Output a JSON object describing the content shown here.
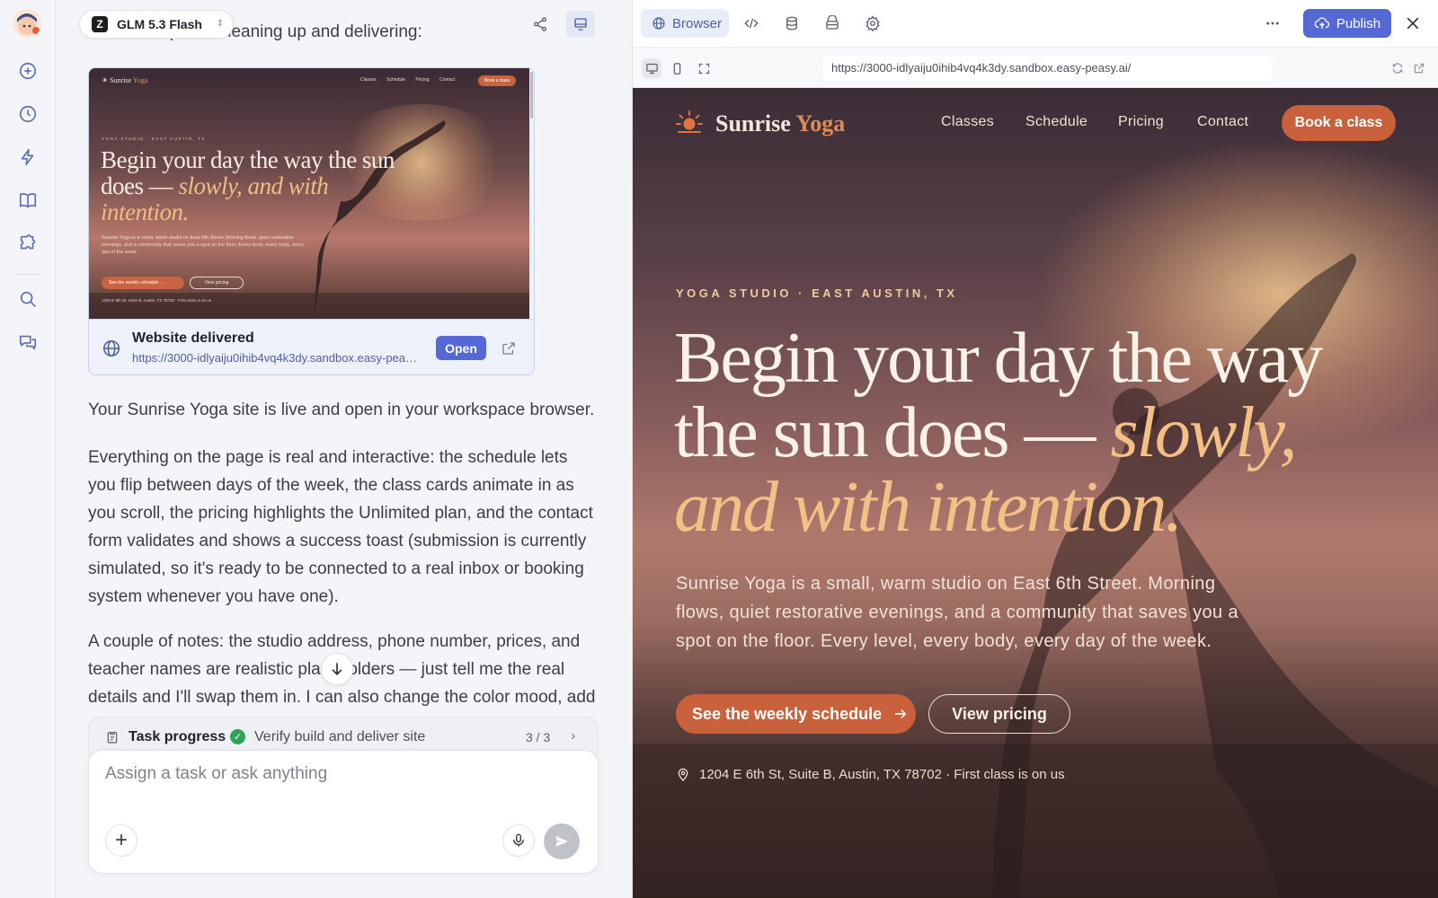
{
  "rail": {
    "icons": [
      "new-chat-icon",
      "history-icon",
      "bolt-icon",
      "book-icon",
      "puzzle-icon",
      "search-icon",
      "chat-bubbles-icon"
    ]
  },
  "chat": {
    "model_name": "GLM 5.3 Flash",
    "cut_text": "All checks pass. Cleaning up and delivering:",
    "preview": {
      "mini_brand": "Sunrise",
      "mini_brand_accent": "Yoga",
      "mini_nav": "Classes Schedule Pricing Contact",
      "mini_book": "Book a class",
      "mini_eyebrow": "YOGA STUDIO · EAST AUSTIN, TX",
      "mini_head_1": "Begin your day the way the sun does —",
      "mini_head_italic": "slowly, and with intention.",
      "mini_desc": "Sunrise Yoga is a small, warm studio on East 6th Street. Morning flows, quiet restorative evenings, and a community that saves you a spot on the floor. Every level, every body, every day of the week.",
      "mini_cta1": "See the weekly schedule →",
      "mini_cta2": "View pricing",
      "mini_addr": "1204 E 6th St, Suite B, Austin, TX 78702 · First class is on us",
      "title": "Website delivered",
      "link": "https://3000-idlyaiju0ihib4vq4k3dy.sandbox.easy-peasy.ai/",
      "open_label": "Open"
    },
    "paragraphs": [
      "Your Sunrise Yoga site is live and open in your workspace browser.",
      "Everything on the page is real and interactive: the schedule lets you flip between days of the week, the class cards animate in as you scroll, the pricing highlights the Unlimited plan, and the contact form validates and shows a success toast (submission is currently simulated, so it's ready to be connected to a real inbox or booking system whenever you have one).",
      "A couple of notes: the studio address, phone number, prices, and teacher names are realistic placeholders — just tell me the real details and I'll swap them in. I can also change the color mood, add"
    ],
    "task": {
      "title": "Task progress",
      "step": "Verify build and deliver site",
      "count": "3 / 3"
    },
    "input_placeholder": "Assign a task or ask anything"
  },
  "browser": {
    "tab_label": "Browser",
    "publish_label": "Publish",
    "url": "https://3000-idlyaiju0ihib4vq4k3dy.sandbox.easy-peasy.ai/"
  },
  "site": {
    "brand": "Sunrise",
    "brand_accent": "Yoga",
    "nav": [
      "Classes",
      "Schedule",
      "Pricing",
      "Contact"
    ],
    "book_label": "Book a class",
    "eyebrow": "YOGA STUDIO · EAST AUSTIN, TX",
    "headline_1": "Begin your day the way",
    "headline_2": "the sun does —",
    "headline_italic_a": "slowly,",
    "headline_italic_b": "and with intention.",
    "description": "Sunrise Yoga is a small, warm studio on East 6th Street. Morning flows, quiet restorative evenings, and a community that saves you a spot on the floor. Every level, every body, every day of the week.",
    "cta_primary": "See the weekly schedule",
    "cta_secondary": "View pricing",
    "address": "1204 E 6th St, Suite B, Austin, TX 78702 · First class is on us",
    "colors": {
      "accent": "#c8613c",
      "headline_italic": "#f4c086",
      "publish": "#5468d6"
    }
  }
}
